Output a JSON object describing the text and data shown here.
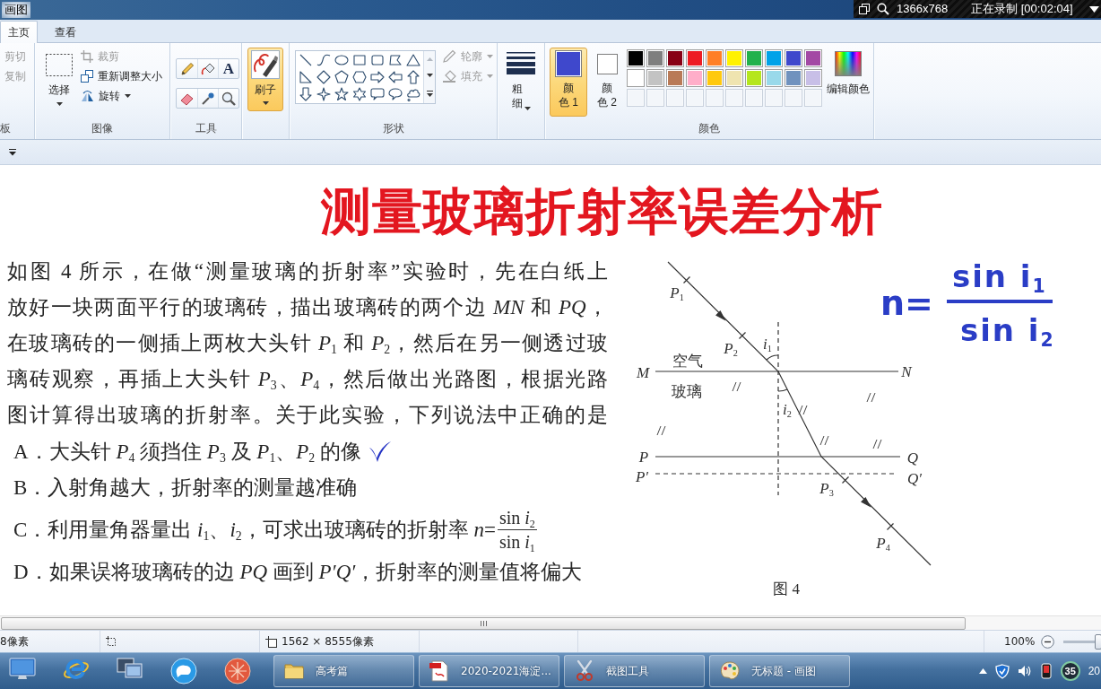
{
  "title_bar": {
    "title": "画图",
    "recorder": {
      "resolution": "1366x768",
      "status": "正在录制 [00:02:04]"
    }
  },
  "ribbon_tabs": [
    {
      "label": "主页",
      "selected": true
    },
    {
      "label": "查看",
      "selected": false
    }
  ],
  "ribbon": {
    "clipboard": {
      "label": "板",
      "commands": [
        {
          "label": "剪切",
          "disabled": true
        },
        {
          "label": "复制",
          "disabled": true
        }
      ]
    },
    "image": {
      "label": "图像",
      "select": "选择",
      "commands": [
        {
          "label": "裁剪",
          "disabled": true,
          "dropdown": false
        },
        {
          "label": "重新调整大小",
          "disabled": false,
          "dropdown": false
        },
        {
          "label": "旋转",
          "disabled": false,
          "dropdown": true
        }
      ]
    },
    "tools": {
      "label": "工具",
      "text_tool": "A"
    },
    "brushes": {
      "label": "刷子",
      "selected": true
    },
    "shapes": {
      "label": "形状",
      "commands": [
        {
          "label": "轮廓",
          "disabled": true,
          "dropdown": true
        },
        {
          "label": "填充",
          "disabled": true,
          "dropdown": true
        }
      ]
    },
    "size": {
      "label": "粗细"
    },
    "colors": {
      "label": "颜色",
      "slots": [
        {
          "label": "颜色 1",
          "color": "#3f48cc",
          "selected": true
        },
        {
          "label": "颜色 2",
          "color": "#ffffff",
          "selected": false
        }
      ],
      "palette": [
        {
          "kind": "swatch",
          "color": "#000000"
        },
        {
          "kind": "swatch",
          "color": "#7f7f7f"
        },
        {
          "kind": "swatch",
          "color": "#880015"
        },
        {
          "kind": "swatch",
          "color": "#ed1c24"
        },
        {
          "kind": "swatch",
          "color": "#ff7f27"
        },
        {
          "kind": "swatch",
          "color": "#fff200"
        },
        {
          "kind": "swatch",
          "color": "#22b14c"
        },
        {
          "kind": "swatch",
          "color": "#00a2e8"
        },
        {
          "kind": "swatch",
          "color": "#3f48cc"
        },
        {
          "kind": "swatch",
          "color": "#a349a4"
        },
        {
          "kind": "swatch",
          "color": "#ffffff"
        },
        {
          "kind": "swatch",
          "color": "#c3c3c3"
        },
        {
          "kind": "swatch",
          "color": "#b97a57"
        },
        {
          "kind": "swatch",
          "color": "#ffaec9"
        },
        {
          "kind": "swatch",
          "color": "#ffc90e"
        },
        {
          "kind": "swatch",
          "color": "#efe4b0"
        },
        {
          "kind": "swatch",
          "color": "#b5e61d"
        },
        {
          "kind": "swatch",
          "color": "#99d9ea"
        },
        {
          "kind": "swatch",
          "color": "#7092be"
        },
        {
          "kind": "swatch",
          "color": "#c8bfe7"
        },
        {
          "kind": "custom"
        },
        {
          "kind": "custom"
        },
        {
          "kind": "custom"
        },
        {
          "kind": "custom"
        },
        {
          "kind": "custom"
        },
        {
          "kind": "custom"
        },
        {
          "kind": "custom"
        },
        {
          "kind": "custom"
        },
        {
          "kind": "custom"
        },
        {
          "kind": "custom"
        }
      ],
      "edit": "编辑颜色"
    }
  },
  "document": {
    "heading": "测量玻璃折射率误差分析",
    "question_lines": [
      "如图 4 所示，在做“测量玻璃的折射率”实验时，先在白纸上",
      "放好一块两面平行的玻璃砖，描出玻璃砖的两个边 *MN* 和 *PQ*，",
      "在玻璃砖的一侧插上两枚大头针 *P*$_{1}$ 和 *P*$_{2}$，然后在另一侧透过玻",
      "璃砖观察，再插上大头针 *P*$_{3}$、*P*$_{4}$，然后做出光路图，根据光路",
      "图计算得出玻璃的折射率。关于此实验，下列说法中正确的是"
    ],
    "options": [
      {
        "letter": "A．",
        "text": "大头针 *P*$_{4}$ 须挡住 *P*$_{3}$ 及 *P*$_{1}$、*P*$_{2}$ 的像",
        "ticked": true
      },
      {
        "letter": "B．",
        "text": "入射角越大，折射率的测量越准确",
        "ticked": false
      },
      {
        "letter": "C．",
        "text": "利用量角器量出 *i*$_{1}$、*i*$_{2}$，可求出玻璃砖的折射率 *n*=",
        "fraction": {
          "numerator": "sin *i*$_{2}$",
          "denominator": "sin *i*$_{1}$"
        },
        "ticked": false
      },
      {
        "letter": "D．",
        "text": "如果误将玻璃砖的边 *PQ* 画到 *P′Q′*，折射率的测量值将偏大",
        "ticked": false
      }
    ],
    "figure": {
      "labels": [
        "*P*$_{1}$",
        "*P*$_{2}$",
        "*i*$_{1}$",
        "空气",
        "*M*",
        "*N*",
        "玻璃",
        "*i*$_{2}$",
        "*P*",
        "*Q*",
        "*P′*",
        "*Q′*",
        "*P*$_{3}$",
        "*P*$_{4}$"
      ],
      "caption": "图 4"
    },
    "formula": {
      "lhs": "n=",
      "numerator": "sin i$_{1}$",
      "denominator": "sin i$_{2}$"
    }
  },
  "status_bar": {
    "cursor": "8像素",
    "canvas_size": "1562 × 8555像素",
    "zoom": "100%",
    "zoom_slider": {
      "level": 0.85
    }
  },
  "taskbar": {
    "tasks": [
      {
        "label": "高考篇"
      },
      {
        "label": "2020-2021海淀..."
      },
      {
        "label": "截图工具"
      },
      {
        "label": "无标题 - 画图"
      }
    ],
    "tray_badge": "35",
    "clock": "20"
  }
}
